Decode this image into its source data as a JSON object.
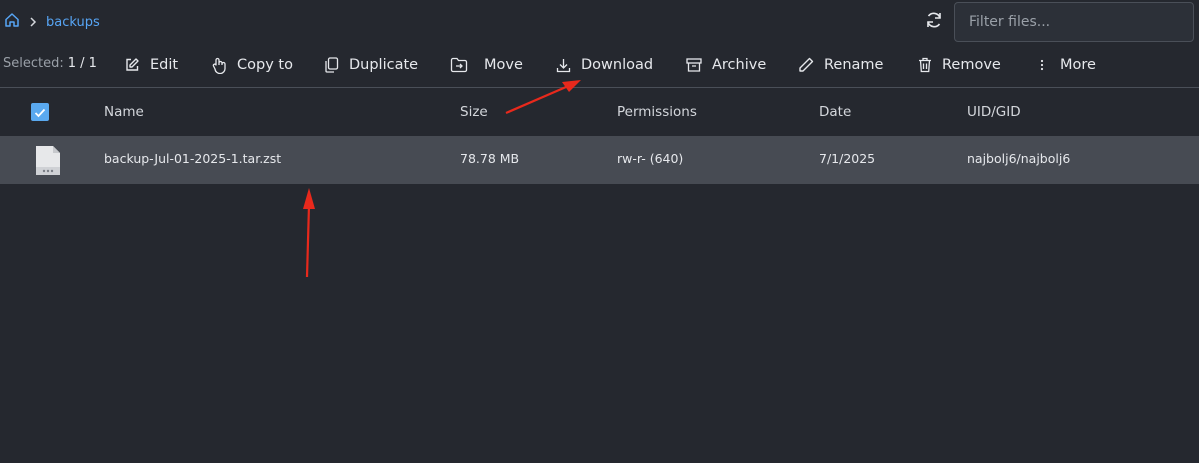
{
  "breadcrumb": {
    "current": "backups"
  },
  "filter": {
    "placeholder": "Filter files..."
  },
  "toolbar": {
    "selected_label": "Selected:",
    "selected_value": "1 / 1",
    "edit": "Edit",
    "copy_to": "Copy to",
    "duplicate": "Duplicate",
    "move": "Move",
    "download": "Download",
    "archive": "Archive",
    "rename": "Rename",
    "remove": "Remove",
    "more": "More"
  },
  "table": {
    "headers": {
      "name": "Name",
      "size": "Size",
      "permissions": "Permissions",
      "date": "Date",
      "uid_gid": "UID/GID"
    },
    "rows": [
      {
        "name": "backup-Jul-01-2025-1.tar.zst",
        "size": "78.78 MB",
        "permissions": "rw-r- (640)",
        "date": "7/1/2025",
        "uid_gid": "najbolj6/najbolj6"
      }
    ]
  },
  "colors": {
    "background": "#25282f",
    "accent": "#57a5f5",
    "selected_row": "#474b53",
    "annotation_arrow": "#e8291c"
  },
  "icons": [
    "home-icon",
    "chevron-right-icon",
    "refresh-icon",
    "edit-icon",
    "copy-to-icon",
    "duplicate-icon",
    "move-icon",
    "download-icon",
    "archive-icon",
    "rename-icon",
    "remove-icon",
    "more-icon",
    "check-icon",
    "file-icon"
  ]
}
